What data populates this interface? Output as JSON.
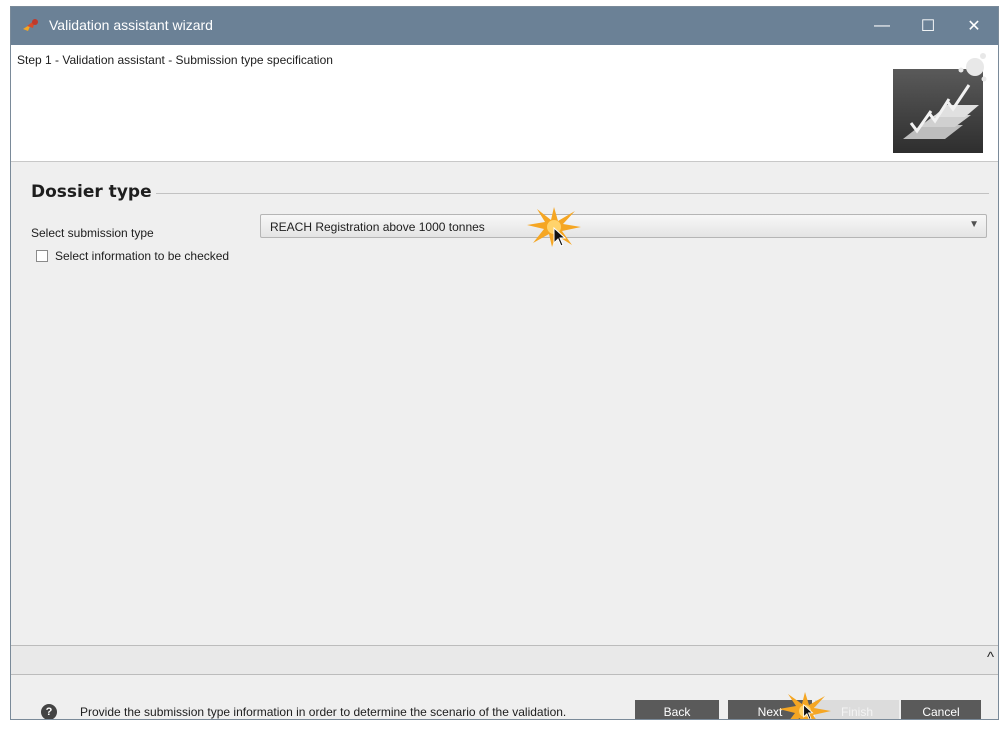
{
  "window": {
    "title": "Validation assistant wizard",
    "controls": {
      "minimize": "—",
      "maximize": "☐",
      "close": "✕"
    }
  },
  "header": {
    "step": "Step 1 - Validation assistant - Submission type specification",
    "logo": "validation-checkmarks-logo"
  },
  "section": {
    "title": "Dossier type"
  },
  "form": {
    "submission_label": "Select submission type",
    "submission_value": "REACH Registration above 1000 tonnes",
    "checkbox_label": "Select information to be checked",
    "checkbox_checked": false
  },
  "footer": {
    "help_icon": "?",
    "help_text": "Provide the submission type information in order to determine the scenario of the validation.",
    "buttons": {
      "back": "Back",
      "next": "Next",
      "finish": "Finish",
      "cancel": "Cancel"
    }
  },
  "colors": {
    "titlebar": "#6b8196",
    "button": "#5a5a5a",
    "highlight": "#f5a623"
  },
  "icons": [
    "app-icon",
    "dropdown-arrow-icon",
    "checkbox-icon",
    "caret-up-icon",
    "help-icon",
    "cursor-icon",
    "click-highlight-icon"
  ]
}
